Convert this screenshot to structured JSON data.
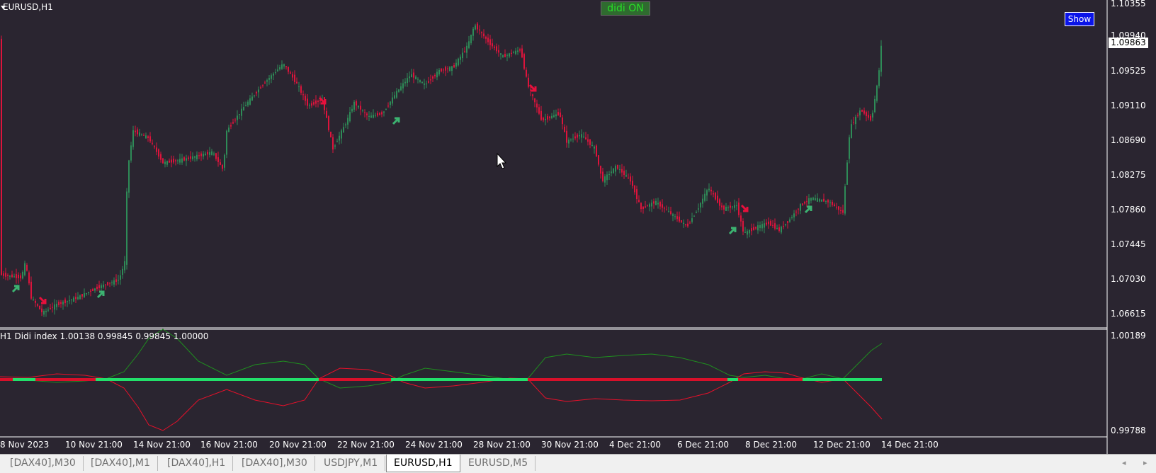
{
  "chart": {
    "symbol_label": "EURUSD,H1",
    "didi_badge": "didi ON",
    "show_button": "Show",
    "indicator_label": "H1 Didi index 1.00138 0.99845 0.99845 1.00000",
    "price_labels": [
      "1.10355",
      "1.09940",
      "1.09525",
      "1.09110",
      "1.08690",
      "1.08275",
      "1.07860",
      "1.07445",
      "1.07030",
      "1.06615"
    ],
    "current_price": "1.09863",
    "indicator_scale": [
      "1.00189",
      "0.99788"
    ],
    "time_labels": [
      "8 Nov 2023",
      "10 Nov 21:00",
      "14 Nov 21:00",
      "16 Nov 21:00",
      "20 Nov 21:00",
      "22 Nov 21:00",
      "24 Nov 21:00",
      "28 Nov 21:00",
      "30 Nov 21:00",
      "4 Dec 21:00",
      "6 Dec 21:00",
      "8 Dec 21:00",
      "12 Dec 21:00",
      "14 Dec 21:00"
    ],
    "colors": {
      "background": "#2a2530",
      "bull_candle": "#2e8b57",
      "bear_candle": "#dc143c",
      "up_arrow": "#3cb371",
      "down_arrow": "#e8103c",
      "didi_green_line": "#1f8f1f",
      "didi_red_line": "#e8102a",
      "baseline_green": "#22e06a",
      "baseline_red": "#d8102a"
    },
    "icons": [
      "cursor-icon",
      "menu-triangle-icon",
      "buy-arrow-icon",
      "sell-arrow-icon"
    ]
  },
  "tabs": [
    {
      "label": "[DAX40],M30",
      "active": false
    },
    {
      "label": "[DAX40],M1",
      "active": false
    },
    {
      "label": "[DAX40],H1",
      "active": false
    },
    {
      "label": "[DAX40],M30",
      "active": false
    },
    {
      "label": "USDJPY,M1",
      "active": false
    },
    {
      "label": "EURUSD,H1",
      "active": true
    },
    {
      "label": "EURUSD,M5",
      "active": false
    }
  ],
  "scroll": {
    "left": "◂",
    "right": "▸"
  }
}
